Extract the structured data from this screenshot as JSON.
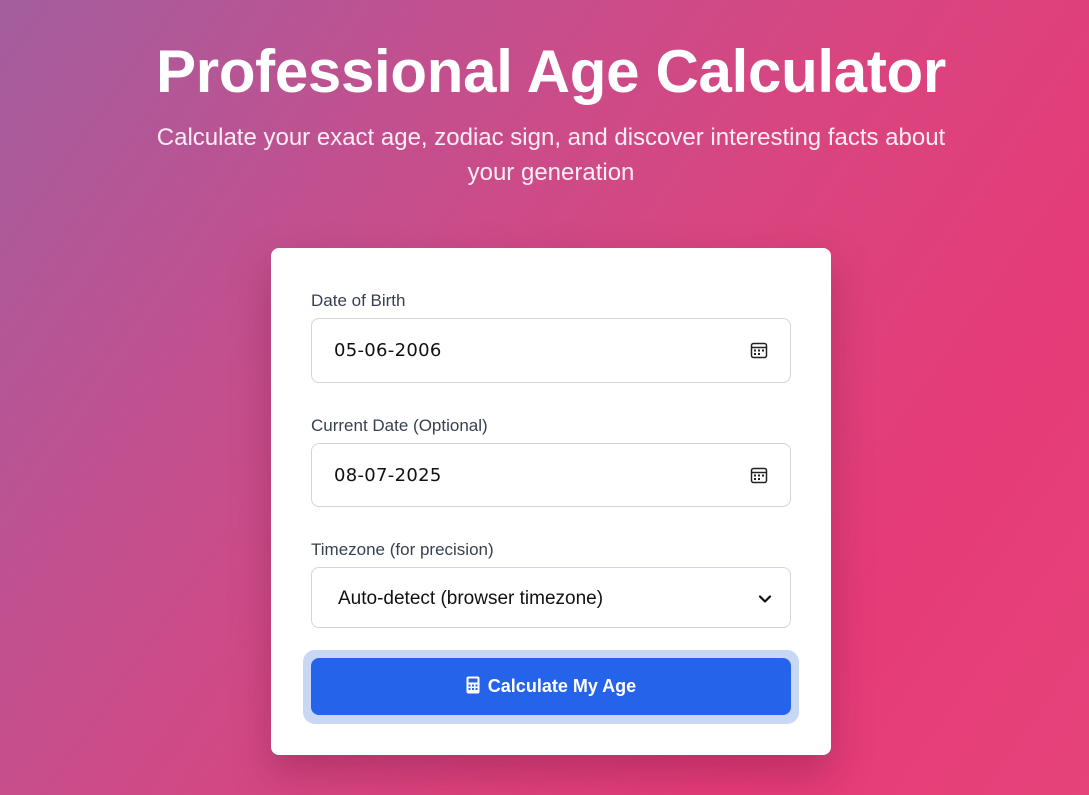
{
  "header": {
    "title": "Professional Age Calculator",
    "subtitle": "Calculate your exact age, zodiac sign, and discover interesting facts about your generation"
  },
  "form": {
    "dob": {
      "label": "Date of Birth",
      "value": "05-06-2006",
      "icon": "calendar-icon"
    },
    "current_date": {
      "label": "Current Date (Optional)",
      "value": "08-07-2025",
      "icon": "calendar-icon"
    },
    "timezone": {
      "label": "Timezone (for precision)",
      "selected": "Auto-detect (browser timezone)",
      "icon": "chevron-down-icon"
    },
    "submit": {
      "label": "Calculate My Age",
      "icon": "calculator-icon"
    }
  },
  "colors": {
    "accent": "#2563eb",
    "background_start": "#a35e9e",
    "background_end": "#e53b78"
  }
}
